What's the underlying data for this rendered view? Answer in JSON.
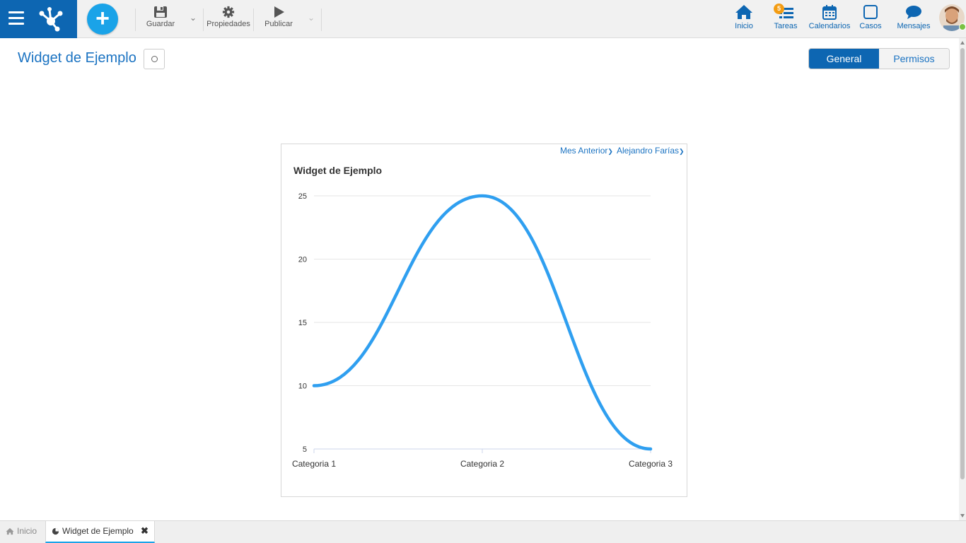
{
  "toolbar": {
    "save_label": "Guardar",
    "properties_label": "Propiedades",
    "publish_label": "Publicar"
  },
  "nav": {
    "home_label": "Inicio",
    "tasks_label": "Tareas",
    "tasks_badge": "5",
    "calendars_label": "Calendarios",
    "cases_label": "Casos",
    "messages_label": "Mensajes"
  },
  "page": {
    "title": "Widget de Ejemplo"
  },
  "tabs": {
    "general": "General",
    "permissions": "Permisos"
  },
  "widget": {
    "period_filter": "Mes Anterior",
    "user_filter": "Alejandro Farías",
    "title": "Widget de Ejemplo"
  },
  "chart_data": {
    "type": "line",
    "title": "Widget de Ejemplo",
    "categories": [
      "Categoria 1",
      "Categoria 2",
      "Categoria 3"
    ],
    "series": [
      {
        "values": [
          10,
          25,
          5
        ]
      }
    ],
    "ylim": [
      5,
      25
    ],
    "yticks": [
      5,
      10,
      15,
      20,
      25
    ],
    "grid": true,
    "color": "#2f9ff0"
  },
  "bottom_tabs": {
    "home": "Inicio",
    "widget": "Widget de Ejemplo"
  },
  "colors": {
    "brand": "#0d66b2",
    "accent": "#1aa3e8"
  }
}
